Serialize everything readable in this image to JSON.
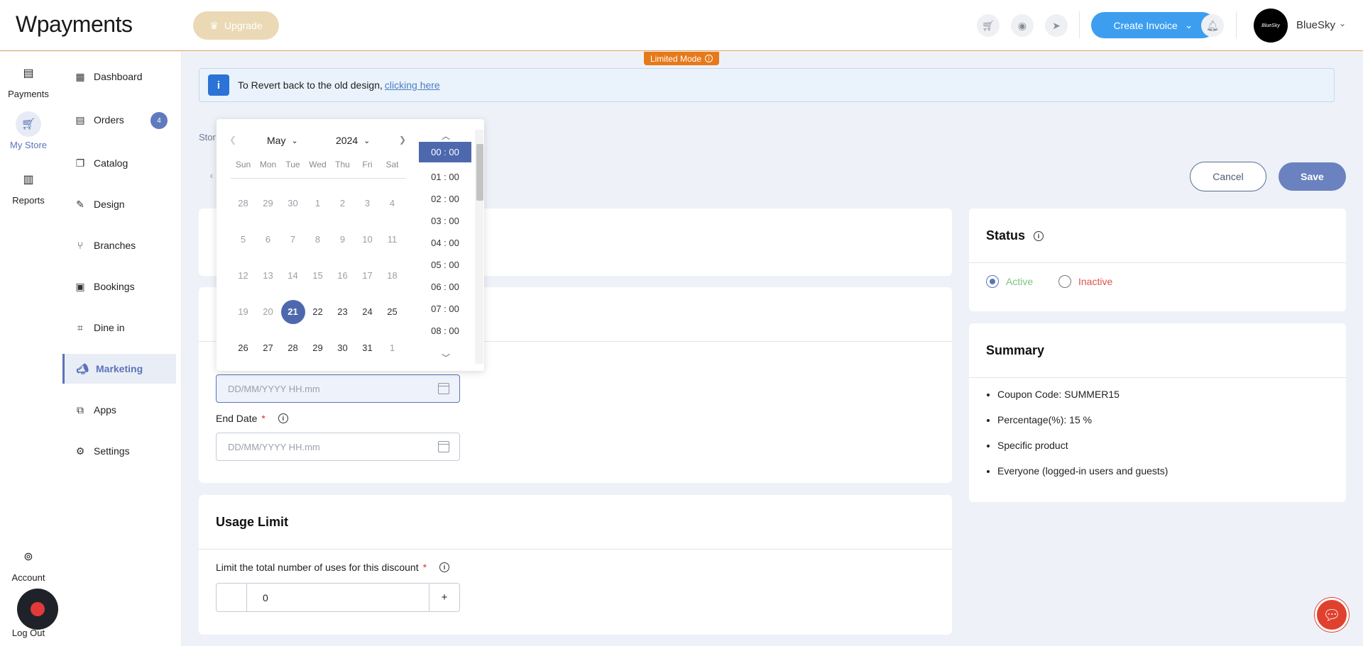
{
  "topbar": {
    "logo_mark": "W",
    "logo_text": "payments",
    "upgrade_label": "Upgrade",
    "create_invoice_label": "Create Invoice",
    "user_name": "BlueSky",
    "avatar_text": "BlueSky"
  },
  "limited_mode": "Limited Mode",
  "rail": [
    {
      "label": "Payments",
      "icon": "payments-icon"
    },
    {
      "label": "My Store",
      "icon": "store-cart-icon"
    },
    {
      "label": "Reports",
      "icon": "reports-icon"
    },
    {
      "label": "Account",
      "icon": "account-icon"
    },
    {
      "label": "Log Out",
      "icon": "logout-icon"
    }
  ],
  "sidebar": [
    {
      "label": "Dashboard",
      "icon": "dashboard-icon"
    },
    {
      "label": "Orders",
      "icon": "orders-icon",
      "badge": "4"
    },
    {
      "label": "Catalog",
      "icon": "catalog-icon"
    },
    {
      "label": "Design",
      "icon": "design-icon"
    },
    {
      "label": "Branches",
      "icon": "branches-icon"
    },
    {
      "label": "Bookings",
      "icon": "bookings-icon"
    },
    {
      "label": "Dine in",
      "icon": "dine-in-icon"
    },
    {
      "label": "Marketing",
      "icon": "marketing-icon"
    },
    {
      "label": "Apps",
      "icon": "apps-icon"
    },
    {
      "label": "Settings",
      "icon": "settings-icon"
    }
  ],
  "notice": {
    "text": "To Revert back to the old design,",
    "link": "clicking here"
  },
  "breadcrumb": "Stor",
  "actions": {
    "cancel": "Cancel",
    "save": "Save"
  },
  "form": {
    "start_date_placeholder": "DD/MM/YYYY HH.mm",
    "end_date_label": "End Date",
    "end_date_placeholder": "DD/MM/YYYY HH.mm",
    "required_mark": "*"
  },
  "usage": {
    "title": "Usage Limit",
    "limit_label": "Limit the total number of uses for this discount",
    "value": "0",
    "plus": "+"
  },
  "status": {
    "title": "Status",
    "active": "Active",
    "inactive": "Inactive",
    "selected": "Active"
  },
  "summary": {
    "title": "Summary",
    "items": [
      "Coupon Code: SUMMER15",
      "Percentage(%): 15 %",
      "Specific product",
      "Everyone (logged-in users and guests)"
    ]
  },
  "picker": {
    "month": "May",
    "year": "2024",
    "weekdays": [
      "Sun",
      "Mon",
      "Tue",
      "Wed",
      "Thu",
      "Fri",
      "Sat"
    ],
    "weeks": [
      [
        "28",
        "29",
        "30",
        "1",
        "2",
        "3",
        "4"
      ],
      [
        "5",
        "6",
        "7",
        "8",
        "9",
        "10",
        "11"
      ],
      [
        "12",
        "13",
        "14",
        "15",
        "16",
        "17",
        "18"
      ],
      [
        "19",
        "20",
        "21",
        "22",
        "23",
        "24",
        "25"
      ],
      [
        "26",
        "27",
        "28",
        "29",
        "30",
        "31",
        "1"
      ]
    ],
    "selected_day": "21",
    "times": [
      "00 : 00",
      "01 : 00",
      "02 : 00",
      "03 : 00",
      "04 : 00",
      "05 : 00",
      "06 : 00",
      "07 : 00",
      "08 : 00"
    ],
    "selected_time": "00 : 00"
  },
  "colors": {
    "accent": "#5a74b8",
    "primary_button": "#3d9ef0",
    "limited_mode": "#e67a1a",
    "active_status": "#7cc47f",
    "inactive_status": "#d9534f"
  }
}
